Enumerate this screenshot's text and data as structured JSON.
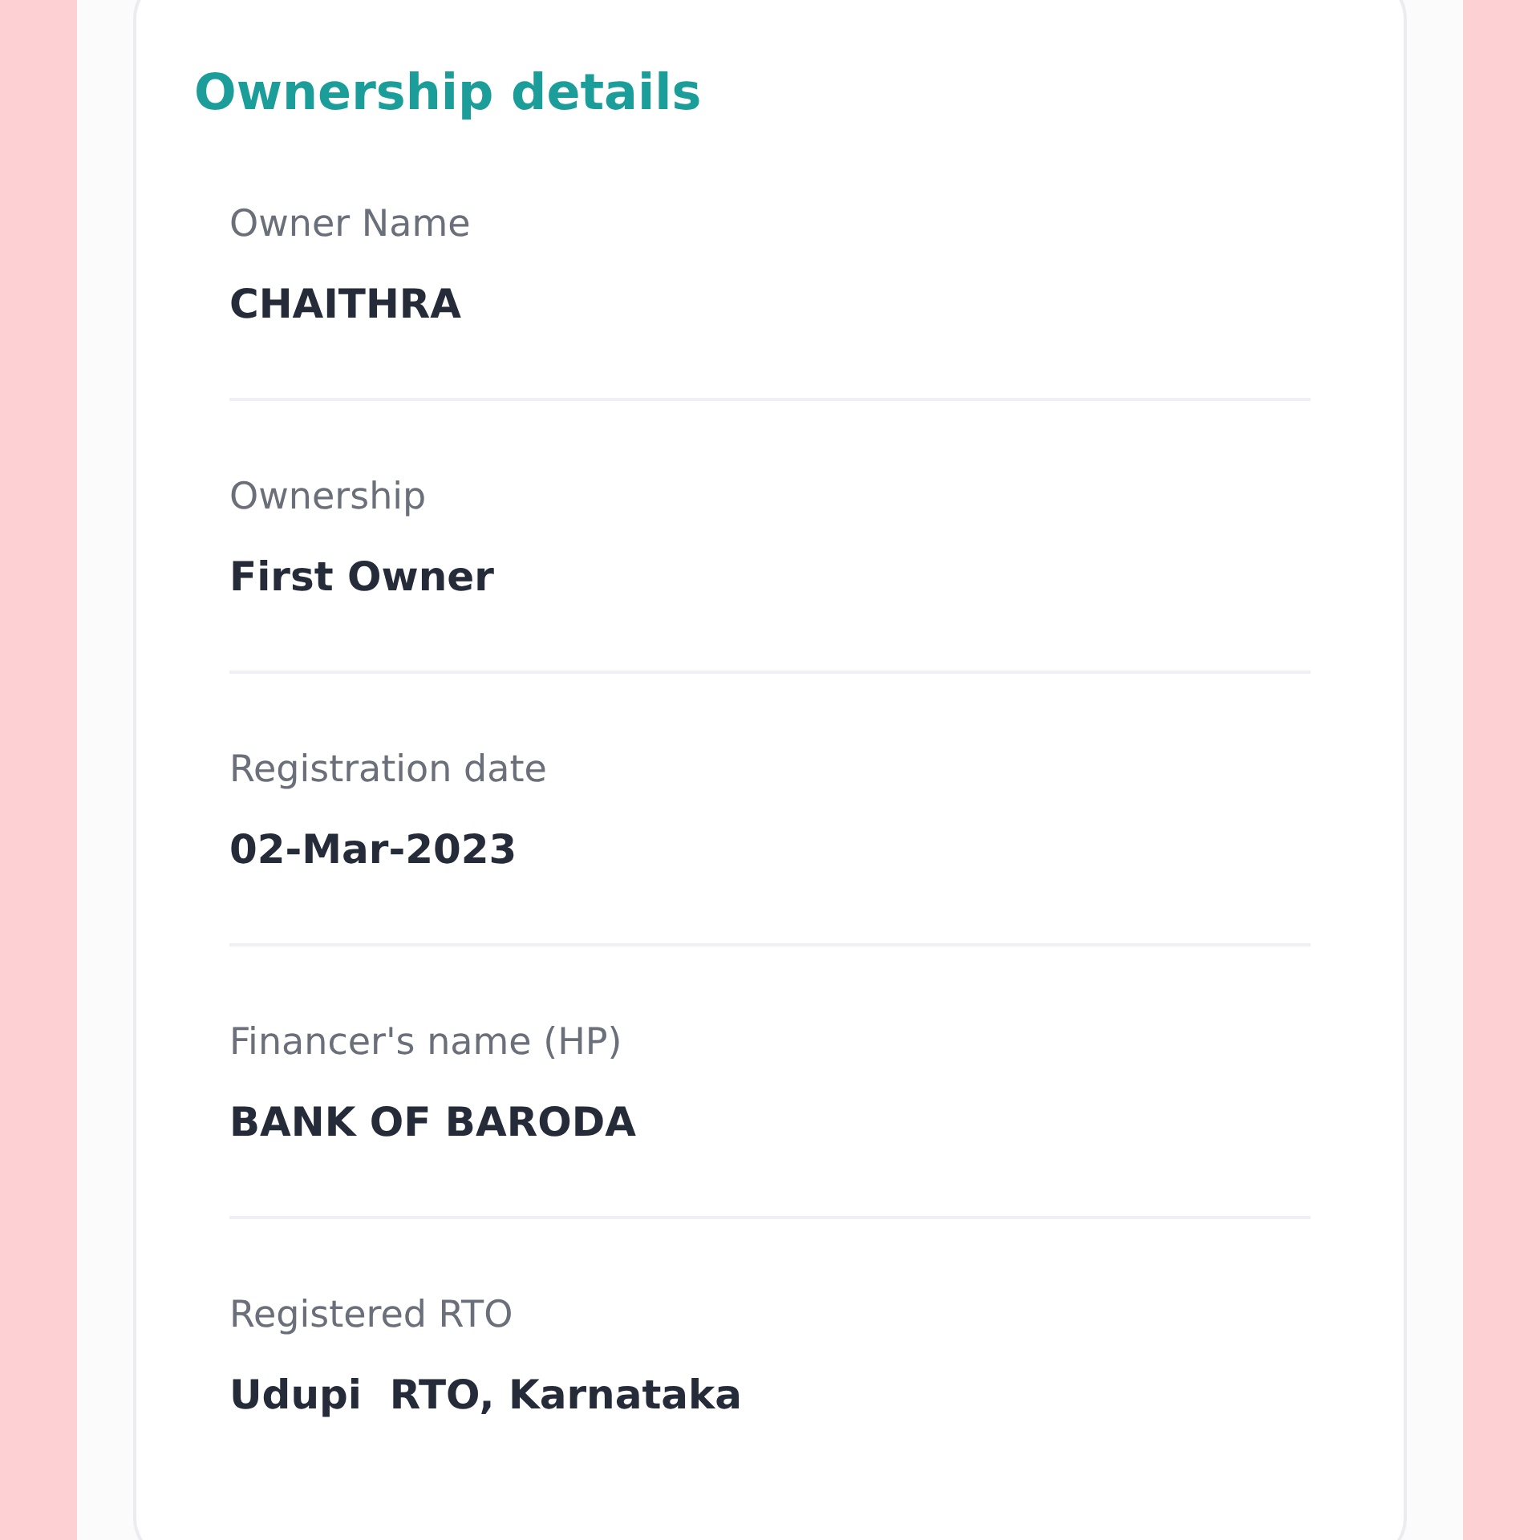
{
  "card": {
    "title": "Ownership details",
    "fields": [
      {
        "label": "Owner Name",
        "value": "CHAITHRA"
      },
      {
        "label": "Ownership",
        "value": "First Owner"
      },
      {
        "label": "Registration date",
        "value": "02-Mar-2023"
      },
      {
        "label": "Financer's name (HP)",
        "value": "BANK OF BARODA"
      },
      {
        "label": "Registered RTO",
        "value": "Udupi  RTO, Karnataka"
      }
    ]
  }
}
